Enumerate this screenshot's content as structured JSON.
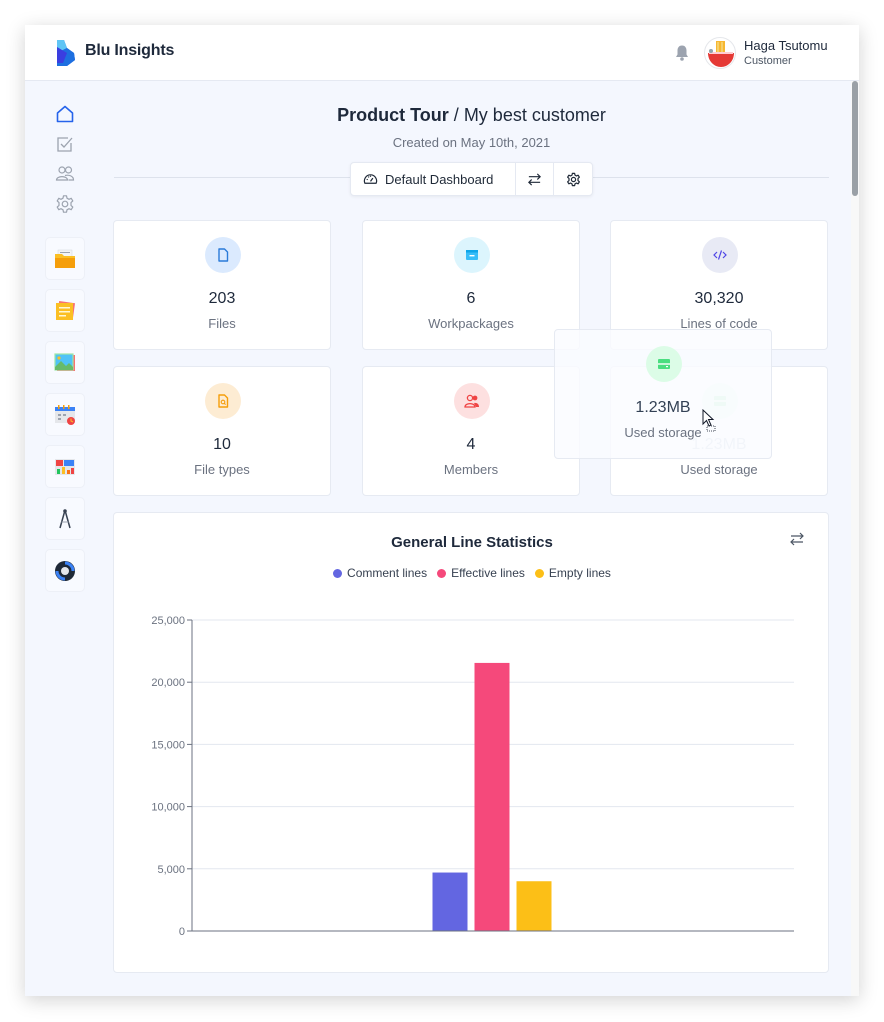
{
  "header": {
    "brand": "Blu Insights",
    "user": {
      "name": "Haga Tsutomu",
      "role": "Customer"
    },
    "icons": {
      "logo": "blu-logo-icon",
      "notifications": "bell-icon",
      "avatar": "ramen-avatar"
    }
  },
  "sidebar": {
    "nav": [
      {
        "name": "home",
        "icon": "home-icon",
        "active": true
      },
      {
        "name": "tasks",
        "icon": "checkbox-icon",
        "active": false
      },
      {
        "name": "users",
        "icon": "users-icon",
        "active": false
      },
      {
        "name": "settings",
        "icon": "gear-icon",
        "active": false
      }
    ],
    "apps": [
      {
        "name": "codebase",
        "icon": "folder-app-icon"
      },
      {
        "name": "notes",
        "icon": "notes-app-icon"
      },
      {
        "name": "gallery",
        "icon": "image-app-icon"
      },
      {
        "name": "calendar",
        "icon": "calendar-app-icon"
      },
      {
        "name": "dashboard",
        "icon": "chart-app-icon"
      },
      {
        "name": "compass",
        "icon": "compass-app-icon"
      },
      {
        "name": "transformation",
        "icon": "cycle-app-icon"
      }
    ]
  },
  "page": {
    "project": "Product Tour",
    "separator": " / ",
    "name": "My best customer",
    "created": "Created on May 10th, 2021"
  },
  "dashboard_bar": {
    "selected": "Default Dashboard",
    "icons": {
      "dashboard": "gauge-icon",
      "switch": "swap-icon",
      "settings": "gear-icon"
    }
  },
  "stats": [
    {
      "value": "203",
      "label": "Files",
      "icon": "file-icon",
      "color": "#2b7bd9",
      "bg": "#dbeafe"
    },
    {
      "value": "6",
      "label": "Workpackages",
      "icon": "archive-icon",
      "color": "#38bdf8",
      "bg": "#dcf5fd"
    },
    {
      "value": "30,320",
      "label": "Lines of code",
      "icon": "code-icon",
      "color": "#4f46e5",
      "bg": "#e8eaf5"
    },
    {
      "value": "10",
      "label": "File types",
      "icon": "file-search-icon",
      "color": "#f59e0b",
      "bg": "#fdecd3"
    },
    {
      "value": "4",
      "label": "Members",
      "icon": "users-icon",
      "color": "#ef4444",
      "bg": "#fde0e0"
    },
    {
      "value": "1.23MB",
      "label": "Used storage",
      "icon": "storage-icon",
      "color": "#4ade80",
      "bg": "#e8fbee"
    }
  ],
  "drag_ghost": {
    "value": "1.23MB",
    "label": "Used storage",
    "icon": "storage-icon"
  },
  "chart_data": {
    "type": "bar",
    "title": "General Line Statistics",
    "categories": [
      ""
    ],
    "series": [
      {
        "name": "Comment lines",
        "color": "#6366e1",
        "values": [
          4700
        ]
      },
      {
        "name": "Effective lines",
        "color": "#f5497b",
        "values": [
          21550
        ]
      },
      {
        "name": "Empty lines",
        "color": "#fcbf17",
        "values": [
          4000
        ]
      }
    ],
    "yticks": [
      "0",
      "5,000",
      "10,000",
      "15,000",
      "20,000",
      "25,000"
    ],
    "ytick_values": [
      0,
      5000,
      10000,
      15000,
      20000,
      25000
    ],
    "ylim": [
      0,
      25000
    ],
    "xlabel": "",
    "ylabel": "",
    "grid": true,
    "legend": "top-center"
  }
}
